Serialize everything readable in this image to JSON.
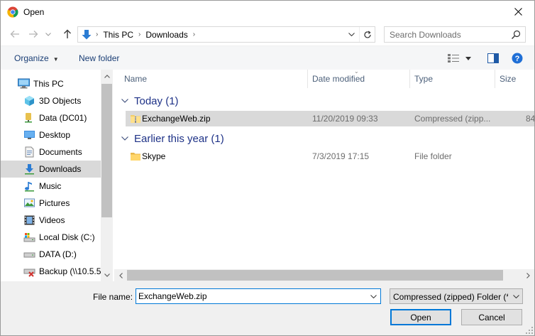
{
  "window": {
    "title": "Open",
    "close_glyph": "✕"
  },
  "address": {
    "crumbs": [
      "This PC",
      "Downloads"
    ],
    "separator": "›"
  },
  "search": {
    "placeholder": "Search Downloads"
  },
  "toolbar": {
    "organize_label": "Organize",
    "new_folder_label": "New folder"
  },
  "nav": {
    "top_item": "This PC",
    "items": [
      "3D Objects",
      "Data (DC01)",
      "Desktop",
      "Documents",
      "Downloads",
      "Music",
      "Pictures",
      "Videos",
      "Local Disk (C:)",
      "DATA (D:)",
      "Backup (\\\\10.5.5"
    ],
    "selected": "Downloads"
  },
  "columns": {
    "name": "Name",
    "date": "Date modified",
    "type": "Type",
    "size": "Size"
  },
  "groups": [
    {
      "label": "Today (1)",
      "files": [
        {
          "name": "ExchangeWeb.zip",
          "date": "11/20/2019 09:33",
          "type": "Compressed (zipp...",
          "size": "84",
          "icon": "zip-folder-icon",
          "selected": true
        }
      ]
    },
    {
      "label": "Earlier this year (1)",
      "files": [
        {
          "name": "Skype",
          "date": "7/3/2019 17:15",
          "type": "File folder",
          "size": "",
          "icon": "folder-icon",
          "selected": false
        }
      ]
    }
  ],
  "bottom": {
    "file_name_label": "File name:",
    "file_name_value": "ExchangeWeb.zip",
    "file_type_value": "Compressed (zipped) Folder (*.zip)",
    "open_label": "Open",
    "cancel_label": "Cancel"
  },
  "colors": {
    "accent": "#0078d7",
    "group_header": "#1e3287",
    "selection": "#d9d9d9"
  }
}
